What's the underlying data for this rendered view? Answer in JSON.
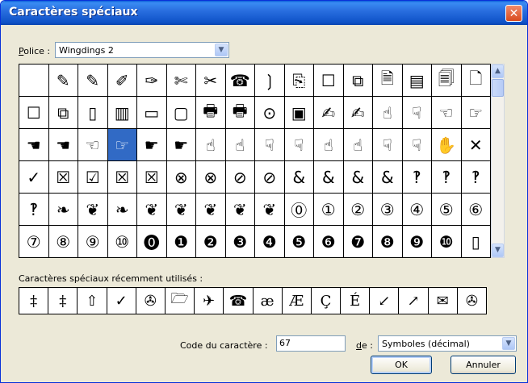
{
  "window": {
    "title": "Caractères spéciaux",
    "close_symbol": "✕"
  },
  "font": {
    "label_underlined": "P",
    "label_rest": "olice :",
    "value": "Wingdings 2",
    "dropdown_icon": "chevron-down-icon"
  },
  "grid": {
    "rows": [
      [
        "",
        "✎",
        "✎",
        "✐",
        "✑",
        "✄",
        "✂",
        "☎",
        "❳",
        "⎘",
        "☐",
        "⧉",
        "🗎",
        "▤",
        "🗐",
        "🗋",
        ""
      ],
      [
        "☐",
        "⧉",
        "▯",
        "▥",
        "▭",
        "▢",
        "🖶",
        "🖶",
        "⊙",
        "▣",
        "✍",
        "✍",
        "☝",
        "☟",
        "☜",
        "☞",
        ""
      ],
      [
        "☚",
        "☚",
        "☜",
        "☞",
        "☛",
        "☛",
        "☝",
        "☝",
        "☟",
        "☟",
        "☝",
        "☝",
        "☟",
        "☟",
        "✋",
        "✕",
        ""
      ],
      [
        "✓",
        "☒",
        "☑",
        "☒",
        "☒",
        "⊗",
        "⊗",
        "⊘",
        "⊘",
        "&",
        "&",
        "&",
        "&",
        "‽",
        "‽",
        "‽",
        ""
      ],
      [
        "‽",
        "❧",
        "❦",
        "❧",
        "❦",
        "❦",
        "❦",
        "❦",
        "❦",
        "⓪",
        "①",
        "②",
        "③",
        "④",
        "⑤",
        "⑥",
        ""
      ],
      [
        "⑦",
        "⑧",
        "⑨",
        "⑩",
        "⓿",
        "❶",
        "❷",
        "❸",
        "❹",
        "❺",
        "❻",
        "❼",
        "❽",
        "❾",
        "❿",
        "▯",
        ""
      ],
      [
        "",
        "",
        "",
        "",
        "",
        "",
        "",
        "",
        "",
        "",
        "",
        "",
        "",
        "",
        "",
        "",
        ""
      ]
    ],
    "selected_row": 2,
    "selected_col": 3
  },
  "scrollbar": {
    "up_symbol": "▲",
    "down_symbol": "▼"
  },
  "recent": {
    "label": "Caractères spéciaux récemment utilisés :",
    "items": [
      "‡",
      "‡",
      "⇧",
      "✓",
      "✇",
      "🗁",
      "✈",
      "☎",
      "æ",
      "Æ",
      "Ç",
      "É",
      "↙",
      "↗",
      "✉",
      "✇"
    ]
  },
  "code": {
    "label": "Code du caractère :",
    "value": "67"
  },
  "de": {
    "label_underlined": "d",
    "label_rest": "e :",
    "value": "Symboles (décimal)"
  },
  "buttons": {
    "ok": "OK",
    "cancel": "Annuler"
  }
}
